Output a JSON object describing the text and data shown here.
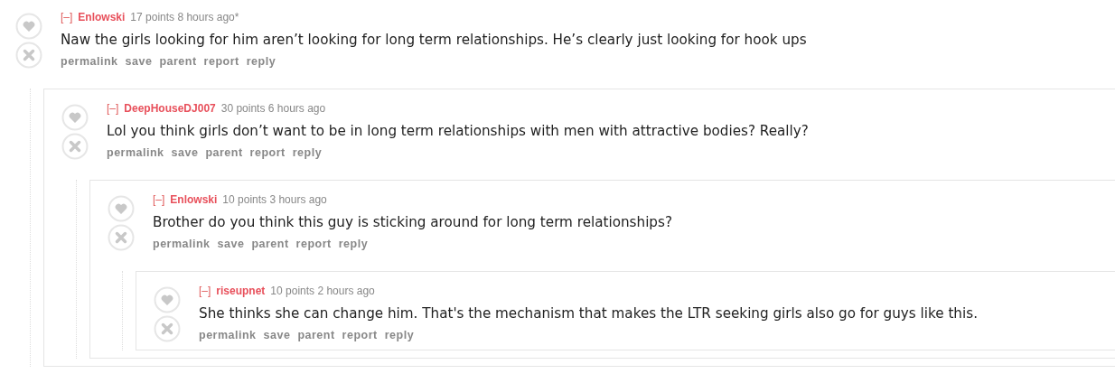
{
  "comments": [
    {
      "toggle": "[–]",
      "author": "Enlowski",
      "meta": "17 points 8 hours ago*",
      "body": "Naw the girls looking for him aren’t looking for long term relationships. He’s clearly just looking for hook ups",
      "actions": [
        "permalink",
        "save",
        "parent",
        "report",
        "reply"
      ],
      "children": [
        {
          "toggle": "[–]",
          "author": "DeepHouseDJ007",
          "meta": "30 points 6 hours ago",
          "body": "Lol you think girls don’t want to be in long term relationships with men with attractive bodies? Really?",
          "actions": [
            "permalink",
            "save",
            "parent",
            "report",
            "reply"
          ],
          "children": [
            {
              "toggle": "[–]",
              "author": "Enlowski",
              "meta": "10 points 3 hours ago",
              "body": "Brother do you think this guy is sticking around for long term relationships?",
              "actions": [
                "permalink",
                "save",
                "parent",
                "report",
                "reply"
              ],
              "children": [
                {
                  "toggle": "[–]",
                  "author": "riseupnet",
                  "meta": "10 points 2 hours ago",
                  "body": "She thinks she can change him. That's the mechanism that makes the LTR seeking girls also go for guys like this.",
                  "actions": [
                    "permalink",
                    "save",
                    "parent",
                    "report",
                    "reply"
                  ]
                }
              ]
            }
          ]
        }
      ]
    }
  ]
}
